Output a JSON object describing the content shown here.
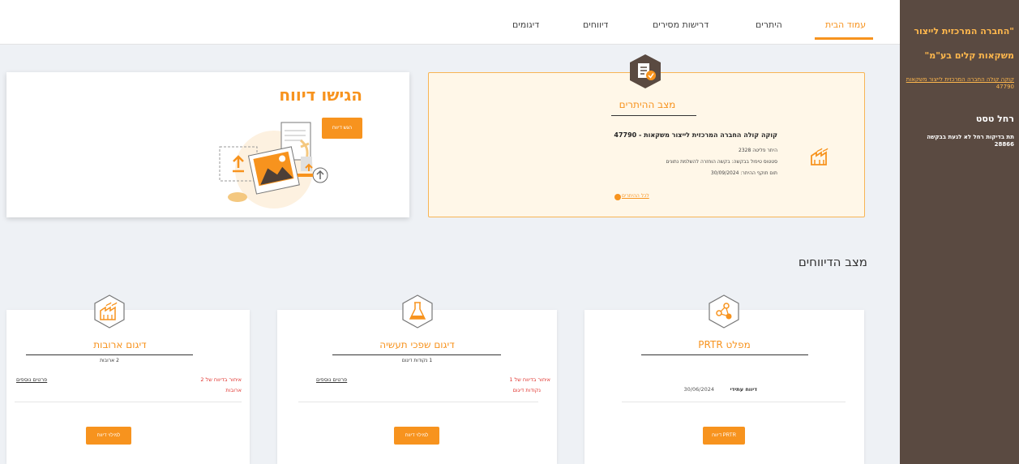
{
  "sidebar": {
    "company_title": "\"החברה המרכזית לייצור משקאות קלים בע\"מ\"",
    "company_link": "קוקה קולה החברה המרכזית לייצור משקאות",
    "company_id": "47790",
    "user_name": "רחל טסט",
    "user_note": "תת בדיקות רחל לא לגעת בבקשה",
    "user_note_id": "28866"
  },
  "nav": {
    "home": "עמוד הבית",
    "permits": "היתרים",
    "regulator_requests": "דרישות מסירים",
    "reports": "דיווחים",
    "samples": "דיגומים"
  },
  "report_card": {
    "title": "הגישו דיווח",
    "button": "הגש דיווח"
  },
  "permit_card": {
    "title": "מצב ההיתרים",
    "company": "קוקה קולה החברה המרכזית לייצור משקאות - 47790",
    "row1": "היתר פליטה 2328",
    "row2": "סטטוס טיפול בבקשה: בקשה הוחזרה להשלמת נתונים",
    "row3": "תום תוקף ההיתר: 30/09/2024",
    "link": "לכל ההיתרים"
  },
  "section_title": "מצב הדיווחים",
  "cards": [
    {
      "title": "מפלט PRTR",
      "meta_label": "דיווח עתידי",
      "meta_value": "30/06/2024",
      "button": "דיווח PRTR"
    },
    {
      "title": "דיגום שפכי תעשיה",
      "sub": "1 נקודות דיגום",
      "warn1": "איחור בדיווח של 1",
      "warn2": "נקודות דיגום",
      "link": "פרטים נוספים",
      "button": "למילוי דיווח"
    },
    {
      "title": "דיגום ארובות",
      "sub": "2 ארובות",
      "warn1": "איחור בדיווח של 2",
      "warn2": "ארובות",
      "link": "פרטים נוספים",
      "button": "למילוי דיווח"
    }
  ],
  "colors": {
    "accent": "#f7931e",
    "sidebar_bg": "#5a4a41",
    "warning": "#e0342f",
    "permit_bg": "#fff7e8"
  }
}
